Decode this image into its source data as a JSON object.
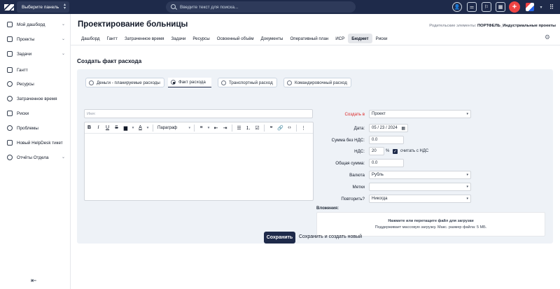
{
  "topbar": {
    "panel_select": "Выберите панель",
    "search_placeholder": "Введите текст для поиска..."
  },
  "sidebar": {
    "items": [
      {
        "label": "Мой дашборд",
        "icon": "dashboard-icon",
        "expandable": true
      },
      {
        "label": "Проекты",
        "icon": "projects-icon",
        "expandable": true
      },
      {
        "label": "Задачи",
        "icon": "tasks-icon",
        "expandable": true
      },
      {
        "label": "Гантт",
        "icon": "gantt-icon",
        "expandable": false
      },
      {
        "label": "Ресурсы",
        "icon": "resources-icon",
        "expandable": false
      },
      {
        "label": "Затраченное время",
        "icon": "time-icon",
        "expandable": false
      },
      {
        "label": "Риски",
        "icon": "risks-icon",
        "expandable": false
      },
      {
        "label": "Проблемы",
        "icon": "problems-icon",
        "expandable": false
      },
      {
        "label": "Новый HelpDesk тикет",
        "icon": "helpdesk-icon",
        "expandable": false
      },
      {
        "label": "Отчёты Отдела",
        "icon": "reports-icon",
        "expandable": true
      }
    ]
  },
  "project": {
    "title": "Проектирование больницы",
    "parents_label": "Родительские элементы:",
    "parents_value": "ПОРТФЕЛЬ_Индустриальные проекты"
  },
  "tabs": [
    "Дашборд",
    "Гантт",
    "Затраченное время",
    "Задачи",
    "Ресурсы",
    "Освоенный объём",
    "Документы",
    "Оперативный план",
    "ИСР",
    "Бюджет",
    "Риски"
  ],
  "active_tab": "Бюджет",
  "form": {
    "section_title": "Создать факт расхода",
    "radio_tabs": [
      "Деньги - планируемые расходы",
      "Факт расхода",
      "Транспортный расход",
      "Командировочный расход"
    ],
    "selected_radio": "Факт расхода",
    "name_placeholder": "Имя:",
    "editor_paragraph": "Параграф",
    "create_in_label": "Создать в",
    "create_in_value": "Проект",
    "date_label": "Дата:",
    "date_value": "05 / 23 / 2024",
    "sum_no_vat_label": "Сумма без НДС:",
    "sum_no_vat_value": "0.0",
    "vat_label": "НДС:",
    "vat_value": "20",
    "vat_unit": "%",
    "vat_checkbox_label": "считать с НДС",
    "total_label": "Общая сумма:",
    "total_value": "0.0",
    "currency_label": "Валюта",
    "currency_value": "Рубль",
    "tags_label": "Метки",
    "tags_value": "",
    "repeat_label": "Повторить?",
    "repeat_value": "Никогда",
    "attachments_label": "Вложения:",
    "dropzone_line1": "Нажмите или перетащите файл для загрузки",
    "dropzone_line2": "Поддерживает массовую загрузку. Макс. размер файла: 5 МБ.",
    "save_button": "Сохранить",
    "save_new_button": "Сохранить и создать новый"
  }
}
